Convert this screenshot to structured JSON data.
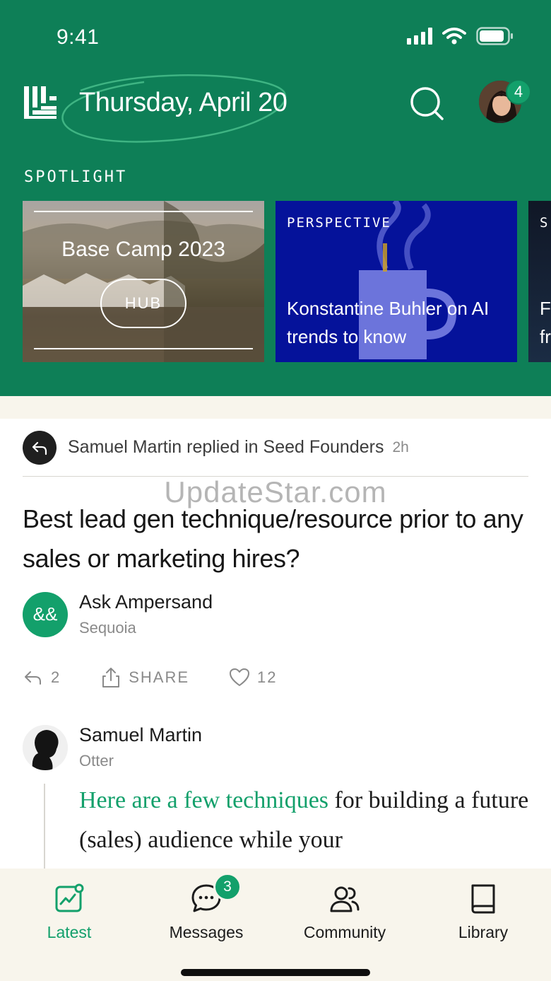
{
  "status_bar": {
    "time": "9:41"
  },
  "header": {
    "date": "Thursday, April 20",
    "notification_count": "4"
  },
  "spotlight": {
    "label": "SPOTLIGHT",
    "cards": [
      {
        "title": "Base Camp 2023",
        "button": "HUB"
      },
      {
        "kicker": "PERSPECTIVE",
        "title": "Konstantine Buhler on AI trends to know"
      },
      {
        "kicker": "S",
        "title": "F fr"
      }
    ]
  },
  "feed": {
    "reply_notice": "Samuel Martin replied in Seed Founders",
    "reply_time": "2h",
    "post_title": "Best lead gen technique/resource prior to any sales or marketing hires?",
    "author": {
      "initials": "&&",
      "name": "Ask Ampersand",
      "org": "Sequoia"
    },
    "actions": {
      "replies": "2",
      "share": "SHARE",
      "likes": "12"
    },
    "reply": {
      "name": "Samuel Martin",
      "org": "Otter",
      "link_text": "Here are a few techniques",
      "body_text": " for building a future (sales) audience while your"
    }
  },
  "watermark": "UpdateStar.com",
  "tabbar": {
    "items": [
      {
        "label": "Latest"
      },
      {
        "label": "Messages"
      },
      {
        "label": "Community"
      },
      {
        "label": "Library"
      }
    ],
    "messages_badge": "3"
  },
  "colors": {
    "brand_green": "#0e7f57",
    "accent_green": "#13a06b",
    "cream": "#f8f5ec"
  }
}
